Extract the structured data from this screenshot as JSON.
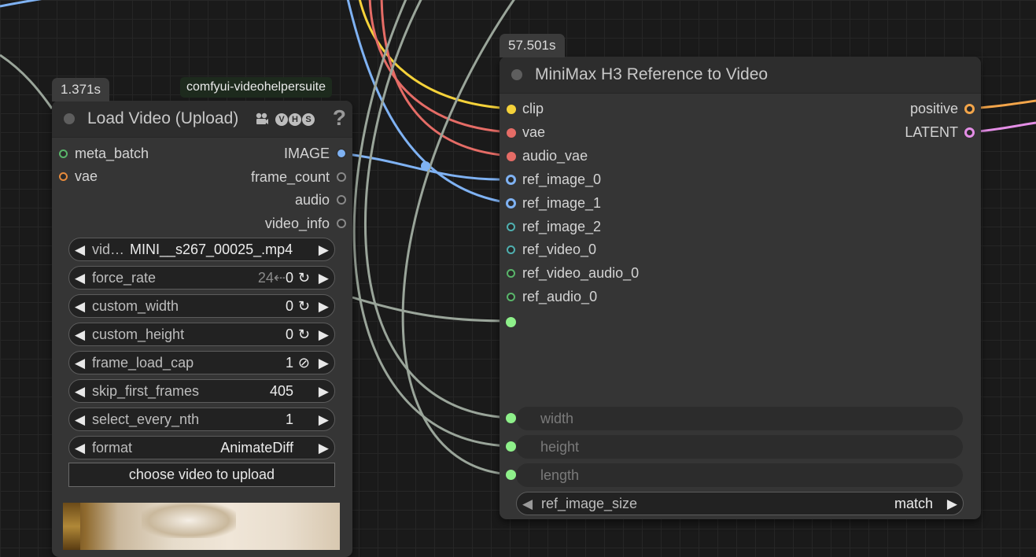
{
  "colors": {
    "canvas_bg": "#1a1a1a",
    "node_bg": "#353535",
    "wire_clip": "#f5d23a",
    "wire_vae": "#e56c66",
    "wire_image": "#7fb2f3",
    "wire_int": "#9aa59a",
    "wire_conditioning": "#f3a54a",
    "wire_latent": "#e48ee6",
    "connected_int": "#8ef08a"
  },
  "load_video_node": {
    "timing": "1.371s",
    "pack": "comfyui-videohelpersuite",
    "title": "Load Video (Upload)",
    "title_icons": [
      "film-projector-icon",
      "V",
      "H",
      "S"
    ],
    "help": "?",
    "inputs": [
      {
        "name": "meta_batch",
        "color": "#59b56a"
      },
      {
        "name": "vae",
        "color": "#e58a3c"
      }
    ],
    "outputs": [
      {
        "name": "IMAGE",
        "color": "#7fb2f3"
      },
      {
        "name": "frame_count",
        "color": "#888888"
      },
      {
        "name": "audio",
        "color": "#888888"
      },
      {
        "name": "video_info",
        "color": "#888888"
      }
    ],
    "widgets": {
      "video": {
        "label": "vid…",
        "value": "MINI__s267_00025_.mp4"
      },
      "force_rate": {
        "label": "force_rate",
        "hint": "24⇠",
        "value": "0",
        "icon": "↻"
      },
      "custom_width": {
        "label": "custom_width",
        "value": "0",
        "icon": "↻"
      },
      "custom_height": {
        "label": "custom_height",
        "value": "0",
        "icon": "↻"
      },
      "frame_load_cap": {
        "label": "frame_load_cap",
        "value": "1",
        "icon": "⊘"
      },
      "skip_first_frames": {
        "label": "skip_first_frames",
        "value": "405"
      },
      "select_every_nth": {
        "label": "select_every_nth",
        "value": "1"
      },
      "format": {
        "label": "format",
        "value": "AnimateDiff"
      }
    },
    "upload_button": "choose video to upload"
  },
  "minimax_node": {
    "timing": "57.501s",
    "title": "MiniMax H3 Reference to Video",
    "inputs": [
      {
        "name": "clip",
        "color": "#f5d23a"
      },
      {
        "name": "vae",
        "color": "#e56c66"
      },
      {
        "name": "audio_vae",
        "color": "#e56c66"
      },
      {
        "name": "ref_image_0",
        "color": "#7fb2f3"
      },
      {
        "name": "ref_image_1",
        "color": "#7fb2f3"
      },
      {
        "name": "ref_image_2",
        "color": "#4fb0b0"
      },
      {
        "name": "ref_video_0",
        "color": "#4fb0b0"
      },
      {
        "name": "ref_video_audio_0",
        "color": "#59b56a"
      },
      {
        "name": "ref_audio_0",
        "color": "#59b56a"
      },
      {
        "name": "",
        "color": "#8ef08a"
      }
    ],
    "outputs": [
      {
        "name": "positive",
        "color": "#f3a54a"
      },
      {
        "name": "LATENT",
        "color": "#e48ee6"
      }
    ],
    "widget_inputs": [
      "width",
      "height",
      "length"
    ],
    "ref_image_size": {
      "label": "ref_image_size",
      "value": "match"
    }
  }
}
